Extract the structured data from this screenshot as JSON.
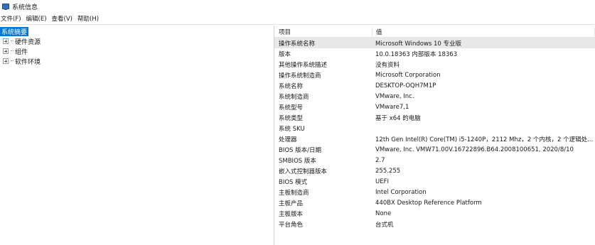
{
  "window": {
    "title": "系统信息",
    "icon": "system-info-icon"
  },
  "menu": [
    "文件(F)",
    "编辑(E)",
    "查看(V)",
    "帮助(H)"
  ],
  "tree": [
    {
      "label": "系统摘要",
      "selected": true,
      "expander": false
    },
    {
      "label": "硬件资源",
      "selected": false,
      "expander": true
    },
    {
      "label": "组件",
      "selected": false,
      "expander": true
    },
    {
      "label": "软件环境",
      "selected": false,
      "expander": true
    }
  ],
  "table": {
    "columns": [
      "项目",
      "值"
    ],
    "rows": [
      {
        "k": "操作系统名称",
        "v": "Microsoft Windows 10 专业版",
        "sel": true
      },
      {
        "k": "版本",
        "v": "10.0.18363 内部版本 18363"
      },
      {
        "k": "其他操作系统描述",
        "v": "没有资料"
      },
      {
        "k": "操作系统制造商",
        "v": "Microsoft Corporation"
      },
      {
        "k": "系统名称",
        "v": "DESKTOP-OQH7M1P"
      },
      {
        "k": "系统制造商",
        "v": "VMware, Inc."
      },
      {
        "k": "系统型号",
        "v": "VMware7,1"
      },
      {
        "k": "系统类型",
        "v": "基于 x64 的电脑"
      },
      {
        "k": "系统 SKU",
        "v": ""
      },
      {
        "k": "处理器",
        "v": "12th Gen Intel(R) Core(TM) i5-1240P，2112 Mhz，2 个内核，2 个逻辑处..."
      },
      {
        "k": "BIOS 版本/日期",
        "v": "VMware, Inc. VMW71.00V.16722896.B64.2008100651, 2020/8/10"
      },
      {
        "k": "SMBIOS 版本",
        "v": "2.7"
      },
      {
        "k": "嵌入式控制器版本",
        "v": "255.255"
      },
      {
        "k": "BIOS 模式",
        "v": "UEFI"
      },
      {
        "k": "主板制造商",
        "v": "Intel Corporation"
      },
      {
        "k": "主板产品",
        "v": "440BX Desktop Reference Platform"
      },
      {
        "k": "主板版本",
        "v": "None"
      },
      {
        "k": "平台角色",
        "v": "台式机"
      }
    ]
  }
}
